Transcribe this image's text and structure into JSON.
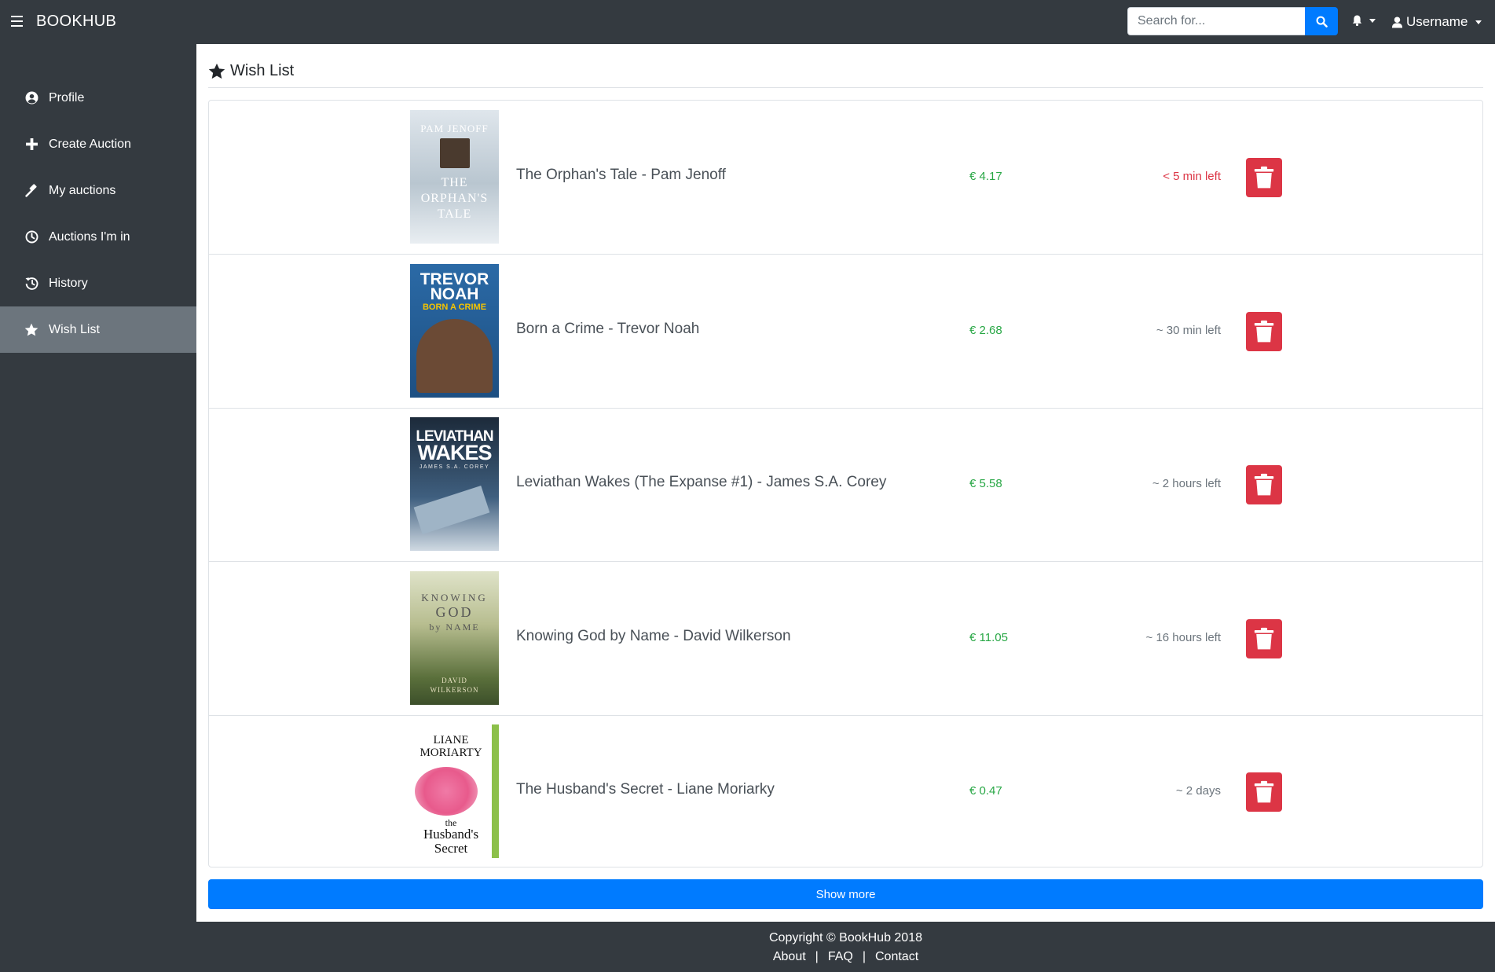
{
  "app": {
    "brand": "BOOKHUB"
  },
  "header": {
    "search_placeholder": "Search for...",
    "username": "Username"
  },
  "sidebar": {
    "items": [
      {
        "label": "Profile",
        "icon": "user-circle-icon"
      },
      {
        "label": "Create Auction",
        "icon": "plus-icon"
      },
      {
        "label": "My auctions",
        "icon": "gavel-icon"
      },
      {
        "label": "Auctions I'm in",
        "icon": "clock-icon"
      },
      {
        "label": "History",
        "icon": "history-icon"
      },
      {
        "label": "Wish List",
        "icon": "star-icon",
        "active": true
      }
    ]
  },
  "page": {
    "title": "Wish List"
  },
  "wishlist": [
    {
      "title": "The Orphan's Tale - Pam Jenoff",
      "price": "€ 4.17",
      "time_left": "< 5 min left",
      "urgent": true,
      "cover": {
        "lines": [
          "PAM JENOFF",
          "THE",
          "ORPHAN'S",
          "TALE"
        ]
      }
    },
    {
      "title": "Born a Crime - Trevor Noah",
      "price": "€ 2.68",
      "time_left": "~ 30 min left",
      "urgent": false,
      "cover": {
        "lines": [
          "TREVOR",
          "NOAH",
          "BORN A CRIME"
        ]
      }
    },
    {
      "title": "Leviathan Wakes (The Expanse #1) - James S.A. Corey",
      "price": "€ 5.58",
      "time_left": "~ 2 hours left",
      "urgent": false,
      "cover": {
        "lines": [
          "LEVIATHAN",
          "WAKES",
          "JAMES S.A. COREY"
        ]
      }
    },
    {
      "title": "Knowing God by Name - David Wilkerson",
      "price": "€ 11.05",
      "time_left": "~ 16 hours left",
      "urgent": false,
      "cover": {
        "lines": [
          "KNOWING",
          "GOD",
          "by NAME",
          "DAVID",
          "WILKERSON"
        ]
      }
    },
    {
      "title": "The Husband's Secret - Liane Moriarky",
      "price": "€ 0.47",
      "time_left": "~ 2 days",
      "urgent": false,
      "cover": {
        "lines": [
          "LIANE",
          "MORIARTY",
          "the",
          "Husband's",
          "Secret"
        ]
      }
    }
  ],
  "show_more_label": "Show more",
  "footer": {
    "copyright": "Copyright © BookHub 2018",
    "links": [
      "About",
      "FAQ",
      "Contact"
    ],
    "separator": "|"
  },
  "colors": {
    "navbar": "#343a40",
    "primary": "#007bff",
    "danger": "#dc3545",
    "success": "#28a745",
    "sidebar_active": "#6c757d"
  }
}
